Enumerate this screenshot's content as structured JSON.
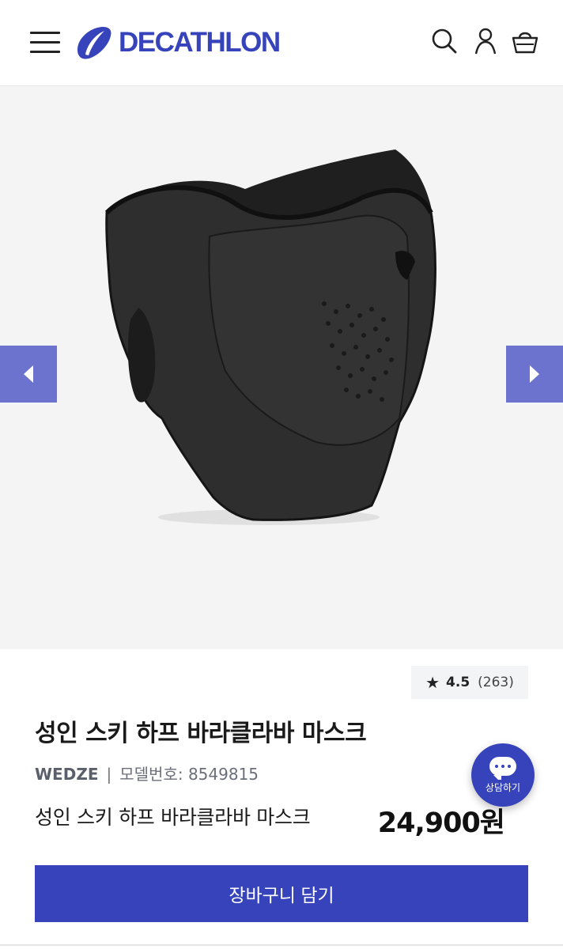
{
  "header": {
    "brand": "DECATHLON",
    "brand_color": "#3643ba",
    "icons": [
      "menu-icon",
      "search-icon",
      "user-icon",
      "basket-icon"
    ]
  },
  "gallery": {
    "background": "#f4f4f4",
    "arrow_color": "#6b73cf"
  },
  "product": {
    "rating_star": "★",
    "rating_score": "4.5",
    "review_count": "(263)",
    "title": "성인 스키 하프 바라클라바 마스크",
    "brand": "WEDZE",
    "separator": "|",
    "model_label": "모델번호: 8549815",
    "subtitle": "성인 스키 하프 바라클라바 마스크",
    "price": "24,900원"
  },
  "chat": {
    "label": "상담하기"
  },
  "cart_button": {
    "label": "장바구니 담기"
  }
}
